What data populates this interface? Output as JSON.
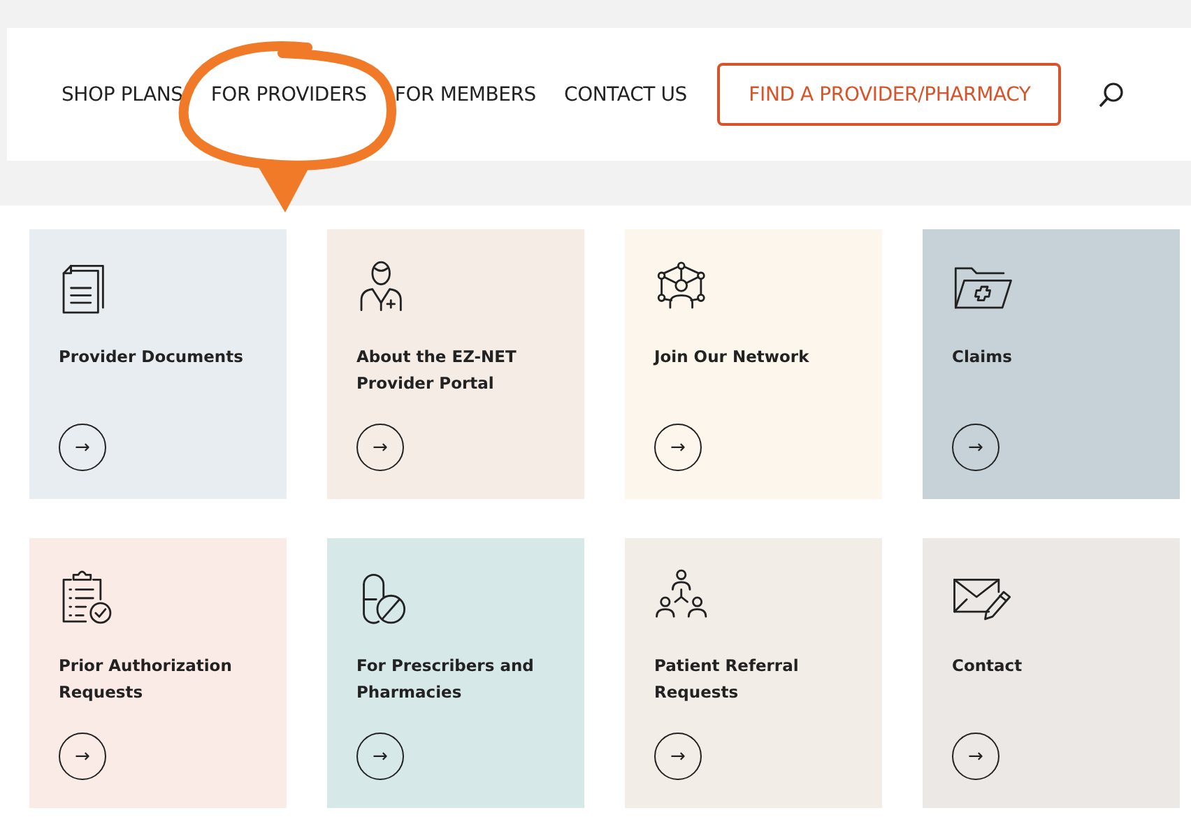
{
  "nav": {
    "items": [
      {
        "label": "SHOP PLANS"
      },
      {
        "label": "FOR PROVIDERS"
      },
      {
        "label": "FOR MEMBERS"
      },
      {
        "label": "CONTACT US"
      }
    ],
    "cta": "FIND A PROVIDER/PHARMACY"
  },
  "cards": [
    {
      "title": "Provider Documents",
      "arrow": "→",
      "color": "#e7edf0"
    },
    {
      "title": "About the EZ-NET Provider Portal",
      "arrow": "→",
      "color": "#f5ece6"
    },
    {
      "title": "Join Our Network",
      "arrow": "→",
      "color": "#fdf6ec"
    },
    {
      "title": "Claims",
      "arrow": "→",
      "color": "#c7d1d8"
    },
    {
      "title": "Prior Authorization Requests",
      "arrow": "→",
      "color": "#fbebe6"
    },
    {
      "title": "For Prescribers and Pharmacies",
      "arrow": "→",
      "color": "#d7e8e8"
    },
    {
      "title": "Patient Referral Requests",
      "arrow": "→",
      "color": "#f3ede7"
    },
    {
      "title": "Contact",
      "arrow": "→",
      "color": "#ece8e5"
    }
  ]
}
